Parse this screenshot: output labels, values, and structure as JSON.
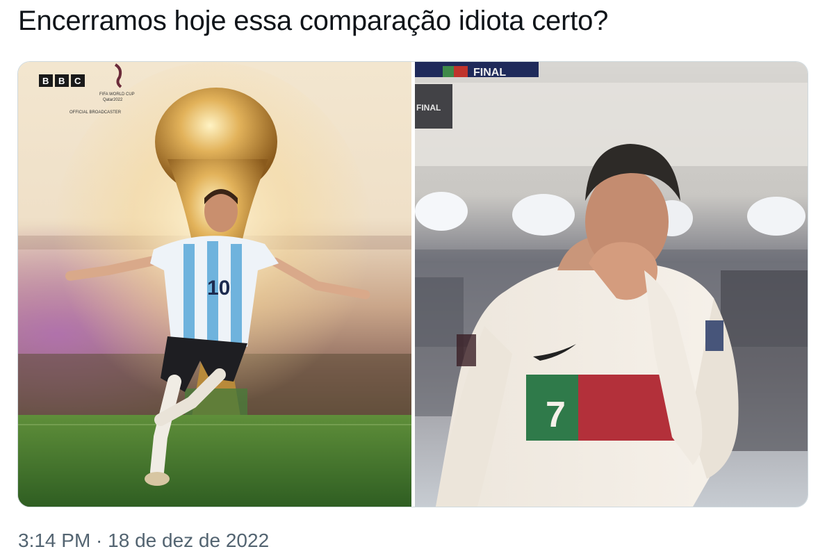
{
  "tweet": {
    "text": "Encerramos hoje essa comparação idiota certo?",
    "timestamp": "3:14 PM · 18 de dez de 2022"
  },
  "media": {
    "left_photo": {
      "broadcaster": "BBC",
      "event_line1": "FIFA WORLD CUP",
      "event_line2": "Qatar2022",
      "event_line3": "OFFICIAL BROADCASTER",
      "shirt_number": "10"
    },
    "right_photo": {
      "banner": "FINAL",
      "overlay_label": "FINAL",
      "shirt_number": "7"
    }
  }
}
